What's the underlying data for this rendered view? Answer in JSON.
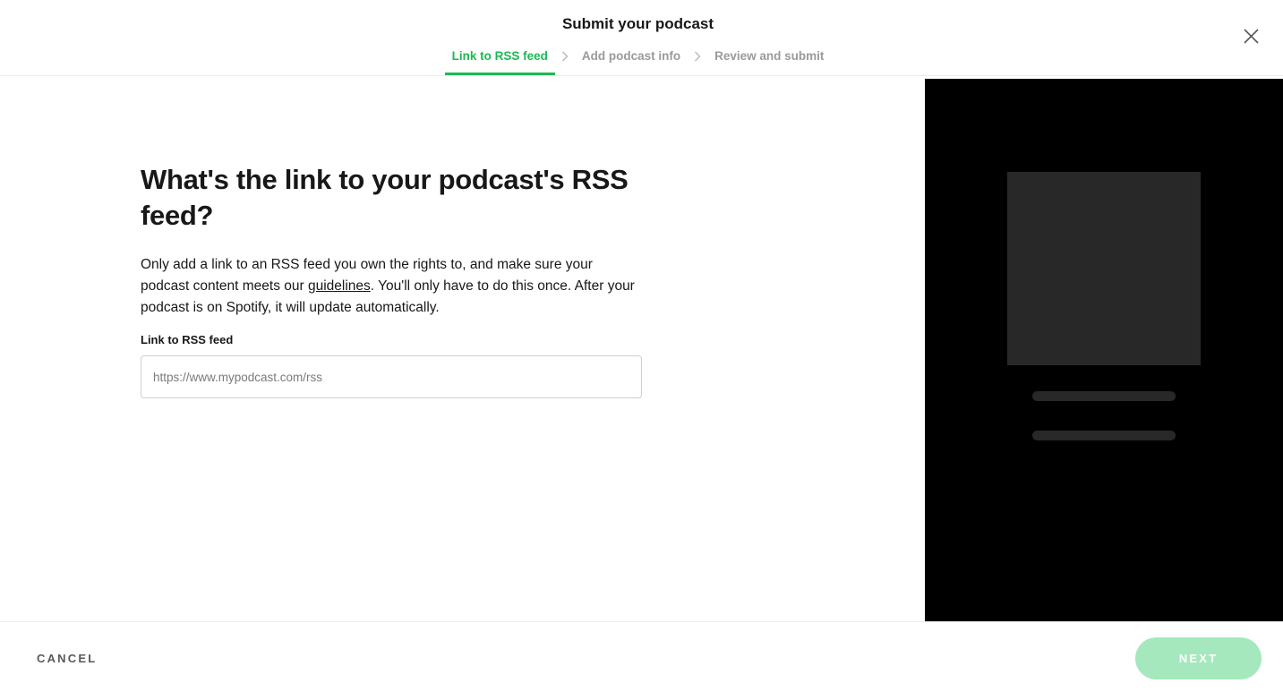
{
  "header": {
    "title": "Submit your podcast",
    "close_icon": "close-icon",
    "steps": [
      {
        "label": "Link to RSS feed",
        "state": "active"
      },
      {
        "label": "Add podcast info",
        "state": "inactive"
      },
      {
        "label": "Review and submit",
        "state": "inactive"
      }
    ],
    "step_separator_icon": "chevron-right-icon"
  },
  "main": {
    "heading": "What's the link to your podcast's RSS feed?",
    "description_before": "Only add a link to an RSS feed you own the rights to, and make sure your podcast content meets our ",
    "description_link": "guidelines",
    "description_after": ". You'll only have to do this once. After your podcast is on Spotify, it will update automatically.",
    "field_label": "Link to RSS feed",
    "field_value": "",
    "field_placeholder": "https://www.mypodcast.com/rss"
  },
  "footer": {
    "cancel_label": "CANCEL",
    "next_label": "NEXT",
    "next_enabled": false
  },
  "colors": {
    "accent": "#1db954",
    "accent_disabled": "#a5e8bd",
    "preview_bg": "#000000",
    "preview_placeholder": "#282828"
  }
}
